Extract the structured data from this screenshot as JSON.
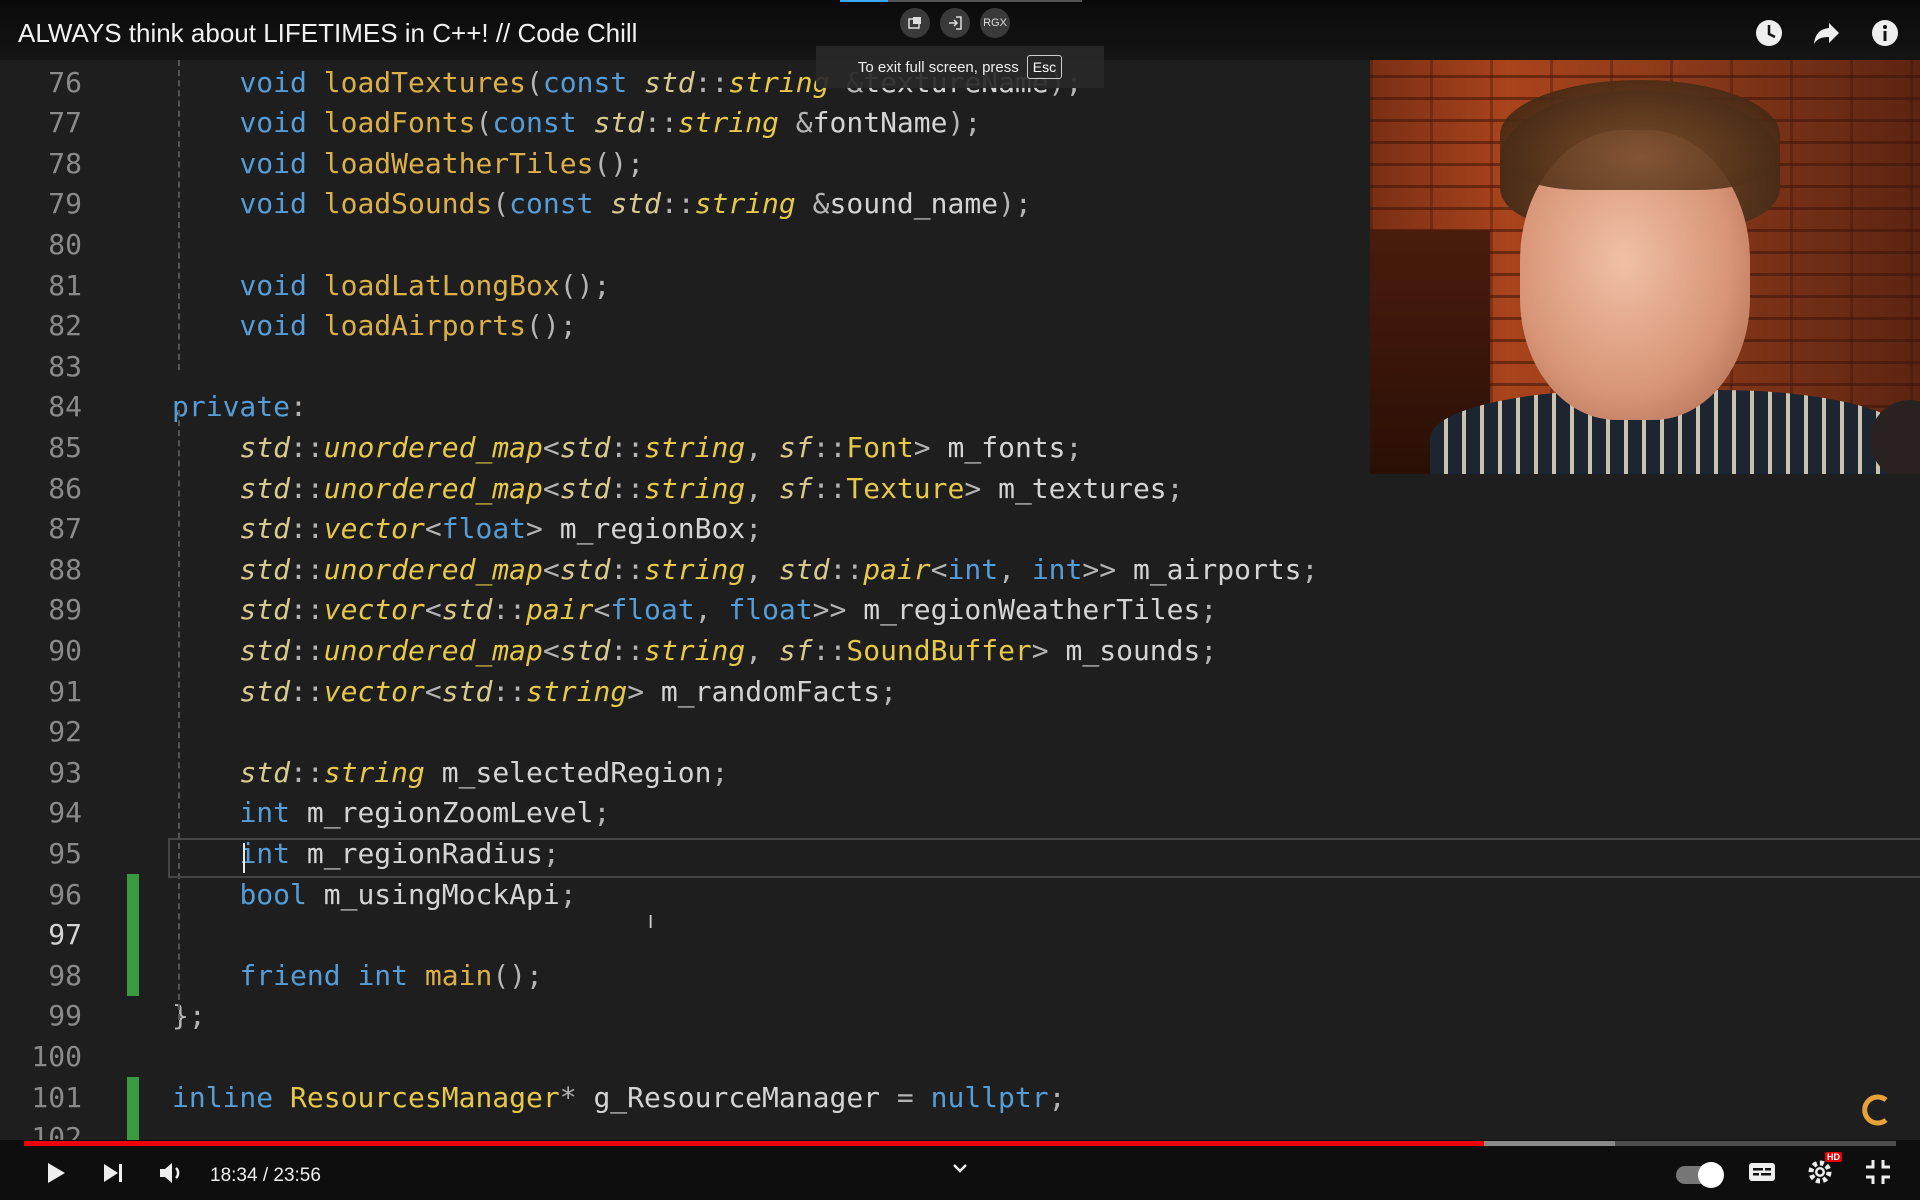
{
  "video": {
    "title": "ALWAYS think about LIFETIMES in C++! // Code Chill",
    "current_time": "18:34",
    "duration": "23:56",
    "time_display": "18:34 / 23:56",
    "progress_fraction": 0.78,
    "buffered_fraction": 0.85
  },
  "fullscreen_tip": {
    "text": "To exit full screen, press",
    "key": "Esc"
  },
  "extension_buttons": [
    "pip-icon",
    "exit-icon",
    "RGX"
  ],
  "editor": {
    "current_line": 97,
    "changed_lines": [
      96,
      97,
      98,
      101,
      102
    ],
    "lines": [
      {
        "n": "76",
        "code": "    void loadTextures(const std::string &textureName);"
      },
      {
        "n": "77",
        "code": "    void loadFonts(const std::string &fontName);"
      },
      {
        "n": "78",
        "code": "    void loadWeatherTiles();"
      },
      {
        "n": "79",
        "code": "    void loadSounds(const std::string &sound_name);"
      },
      {
        "n": "80",
        "code": ""
      },
      {
        "n": "81",
        "code": "    void loadLatLongBox();"
      },
      {
        "n": "82",
        "code": "    void loadAirports();"
      },
      {
        "n": "83",
        "code": ""
      },
      {
        "n": "84",
        "code": "private:"
      },
      {
        "n": "85",
        "code": "    std::unordered_map<std::string, sf::Font> m_fonts;"
      },
      {
        "n": "86",
        "code": "    std::unordered_map<std::string, sf::Texture> m_textures;"
      },
      {
        "n": "87",
        "code": "    std::vector<float> m_regionBox;"
      },
      {
        "n": "88",
        "code": "    std::unordered_map<std::string, std::pair<int, int>> m_airports;"
      },
      {
        "n": "89",
        "code": "    std::vector<std::pair<float, float>> m_regionWeatherTiles;"
      },
      {
        "n": "90",
        "code": "    std::unordered_map<std::string, sf::SoundBuffer> m_sounds;"
      },
      {
        "n": "91",
        "code": "    std::vector<std::string> m_randomFacts;"
      },
      {
        "n": "92",
        "code": ""
      },
      {
        "n": "93",
        "code": "    std::string m_selectedRegion;"
      },
      {
        "n": "94",
        "code": "    int m_regionZoomLevel;"
      },
      {
        "n": "95",
        "code": "    int m_regionRadius;"
      },
      {
        "n": "96",
        "code": "    bool m_usingMockApi;"
      },
      {
        "n": "97",
        "code": "    "
      },
      {
        "n": "98",
        "code": "    friend int main();"
      },
      {
        "n": "99",
        "code": "};"
      },
      {
        "n": "100",
        "code": ""
      },
      {
        "n": "101",
        "code": "inline ResourcesManager* g_ResourceManager = nullptr;"
      },
      {
        "n": "102",
        "code": ""
      }
    ]
  },
  "colors": {
    "keyword": "#569cd6",
    "function": "#dcb049",
    "type": "#e6c84a",
    "namespace": "#d7ca8f",
    "identifier": "#d4d4d4",
    "change_bar": "#3a9a3f",
    "progress": "#ee0000"
  }
}
